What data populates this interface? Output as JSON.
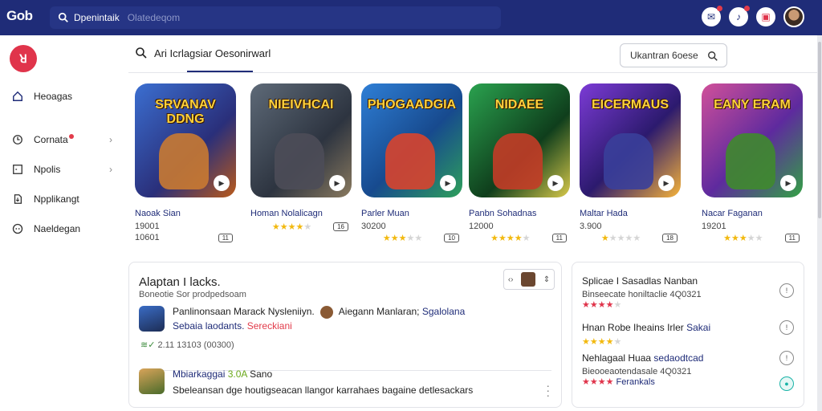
{
  "app": {
    "logo": "Gob",
    "brand_color": "#1f2c78",
    "accent_color": "#e0344b"
  },
  "topbar": {
    "search_value": "Dpenintaik",
    "search_placeholder": "Olatedeqom",
    "icons": [
      "chat-icon",
      "bell-icon",
      "gift-icon",
      "profile-avatar"
    ]
  },
  "sidebar": {
    "logo_glyph": "ꓤ",
    "items": [
      {
        "label": "Heoagas",
        "icon": "home-icon",
        "chevron": false,
        "dot": false
      },
      {
        "label": "Cornata",
        "icon": "clock-icon",
        "chevron": true,
        "dot": true
      },
      {
        "label": "Npolis",
        "icon": "square-icon",
        "chevron": true,
        "dot": false
      },
      {
        "label": "Npplikangt",
        "icon": "download-icon",
        "chevron": false,
        "dot": false
      },
      {
        "label": "Naeldegan",
        "icon": "gamepad-icon",
        "chevron": false,
        "dot": false
      }
    ]
  },
  "main": {
    "search_label": "Ari Icrlagsiar Oesonirwarl",
    "filter_label": "Ukantran 6oese"
  },
  "cards": [
    {
      "title_art": "SRVANAV DDNG",
      "name": "Naoak Sian",
      "num1": "19001",
      "num2": "10601",
      "stars": 0,
      "tag": "11",
      "bg": "linear-gradient(135deg,#3b6fd1,#2a2f7a 60%,#ba5a1b)",
      "fig": "#c97a32"
    },
    {
      "title_art": "NIEIVHCAI",
      "name": "Homan Nolalicagn",
      "num1": "",
      "num2": "",
      "stars": 4,
      "tag": "16",
      "bg": "linear-gradient(135deg,#5e6a78,#2d3440 60%,#8a7a5f)",
      "fig": "#4d4d58"
    },
    {
      "title_art": "PHOGAADGIA",
      "name": "Parler Muan",
      "num1": "30200",
      "num2": "",
      "stars": 3,
      "tag": "10",
      "bg": "linear-gradient(135deg,#2f7fd6,#174a8e 55%,#2ea05b)",
      "fig": "#d8442e"
    },
    {
      "title_art": "NIDAEE",
      "name": "Panbn Sohadnas",
      "num1": "12000",
      "num2": "",
      "stars": 4,
      "tag": "11",
      "bg": "linear-gradient(135deg,#2aa24f,#0f3e1c 60%,#d8c94a)",
      "fig": "#c33c27"
    },
    {
      "title_art": "EICERMAUS",
      "name": "Maltar Hada",
      "num1": "3.900",
      "num2": "",
      "stars": 1,
      "tag": "18",
      "bg": "linear-gradient(135deg,#7c3bd6,#2c1a6e 55%,#f6b33a)",
      "fig": "#3a3f9a"
    },
    {
      "title_art": "EANY ERAM",
      "name": "Nacar Faganan",
      "num1": "19201",
      "num2": "",
      "stars": 3,
      "tag": "11",
      "bg": "linear-gradient(135deg,#d1509a,#5e2a9e 55%,#33a244)",
      "fig": "#3f8a2e"
    }
  ],
  "panel_left": {
    "title": "Alaptan I lacks.",
    "subtitle": "Boneotie Sor prodpedsoam",
    "dropdown_tag": "‹›",
    "review1": {
      "text_a": "Panlinonsaan Marack Nysleniiyn.",
      "text_b": "Aiegann Manlaran;",
      "text_c": "Sgalolana",
      "text_d": "Sebaia laodants.",
      "text_e": "Sereckiani",
      "meta": "2.11 13103 (00300)"
    },
    "review2": {
      "text_a": "Mbiarkaggai",
      "text_b": "3.0A",
      "text_c": "Sano",
      "text_d": "Sbeleansan dge houtigseacan llangor karrahaes bagaine detlesackars"
    }
  },
  "panel_right": {
    "items": [
      {
        "title": "Splicae I Sasadlas Nanban",
        "title_hl": "",
        "sub": "Binseecate honiltaclie 4Q0321",
        "stars": 4
      },
      {
        "title": "Hnan Robe Iheains Irler",
        "title_hl": "Sakai",
        "sub": "",
        "stars": 4
      },
      {
        "title": "Nehlagaal Huaa",
        "title_hl": "sedaodtcad",
        "sub": "Bieooeaotendasale 4Q0321",
        "stars": 4,
        "extra": "Ferankals"
      }
    ]
  }
}
